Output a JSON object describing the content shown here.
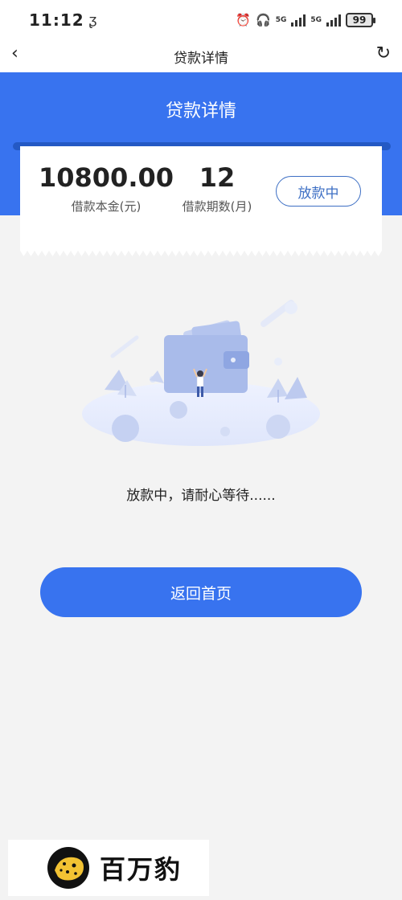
{
  "status_bar": {
    "time": "11:12",
    "headset_icon": "headphones-icon",
    "alarm_icon": "alarm-icon",
    "network_1": "5G",
    "network_2": "5G",
    "battery": "99"
  },
  "nav": {
    "back_icon": "chevron-left-icon",
    "title": "贷款详情",
    "refresh_icon": "refresh-icon"
  },
  "header": {
    "title": "贷款详情"
  },
  "loan": {
    "amount": "10800.00",
    "amount_label": "借款本金(元)",
    "term": "12",
    "term_label": "借款期数(月)",
    "status": "放款中"
  },
  "message": "放款中，请耐心等待......",
  "home_button": "返回首页",
  "watermark": {
    "text": "百万豹"
  },
  "colors": {
    "primary": "#3873ef",
    "status_outline": "#3d6fc4",
    "background": "#f3f3f3"
  }
}
